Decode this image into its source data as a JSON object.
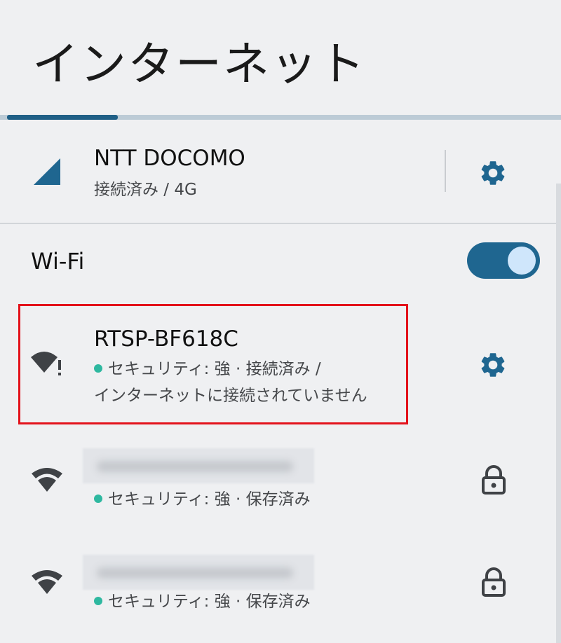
{
  "page": {
    "title": "インターネット"
  },
  "mobile": {
    "name": "NTT DOCOMO",
    "status": "接続済み / 4G",
    "icon": "cellular-signal-icon"
  },
  "wifi": {
    "label": "Wi-Fi",
    "enabled": true
  },
  "networks": [
    {
      "name": "RTSP-BF618C",
      "status_line1": "セキュリティ: 強 · 接続済み /",
      "status_line2": "インターネットに接続されていません",
      "icon": "wifi-no-internet-icon",
      "action_icon": "gear-icon"
    },
    {
      "name": "",
      "status_line1": "セキュリティ: 強 · 保存済み",
      "icon": "wifi-icon",
      "action_icon": "lock-icon"
    },
    {
      "name": "",
      "status_line1": "セキュリティ: 強 · 保存済み",
      "icon": "wifi-icon",
      "action_icon": "lock-icon"
    }
  ],
  "colors": {
    "accent": "#1f6690",
    "status_dot": "#2eb8a0",
    "highlight": "#e3121b"
  }
}
